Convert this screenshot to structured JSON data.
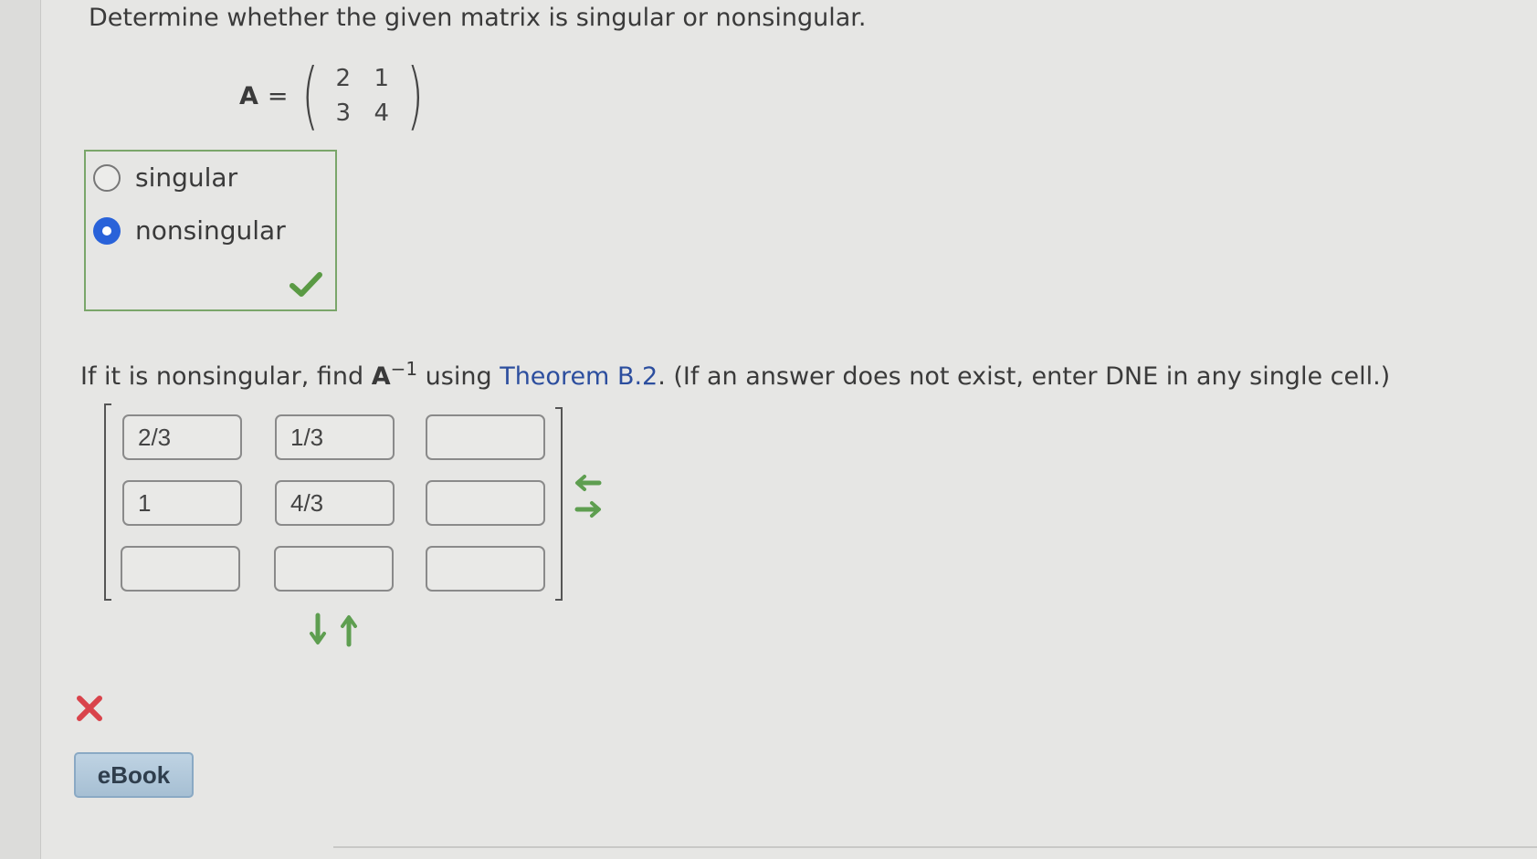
{
  "question1": {
    "prompt": "Determine whether the given matrix is singular or nonsingular.",
    "matrix_name": "A",
    "equals": "=",
    "matrix": [
      [
        "2",
        "1"
      ],
      [
        "3",
        "4"
      ]
    ]
  },
  "choices": [
    {
      "label": "singular",
      "selected": false
    },
    {
      "label": "nonsingular",
      "selected": true
    }
  ],
  "question2": {
    "prefix": "If it is nonsingular, find ",
    "inverse_base": "A",
    "inverse_exp": "−1",
    "middle": " using ",
    "link_text": "Theorem B.2",
    "suffix": ". (If an answer does not exist, enter DNE in any single cell.)"
  },
  "answer_cells": [
    [
      "2/3",
      "1/3",
      ""
    ],
    [
      "1",
      "4/3",
      ""
    ],
    [
      "",
      "",
      ""
    ]
  ],
  "status": {
    "part1": "correct",
    "part2": "incorrect"
  },
  "colors": {
    "check": "#5a9a44",
    "cross": "#d9434b",
    "arrows": "#5e9e50",
    "radio_selected": "#2962d9",
    "link": "#2c4e9e"
  },
  "ebook_label": "eBook"
}
